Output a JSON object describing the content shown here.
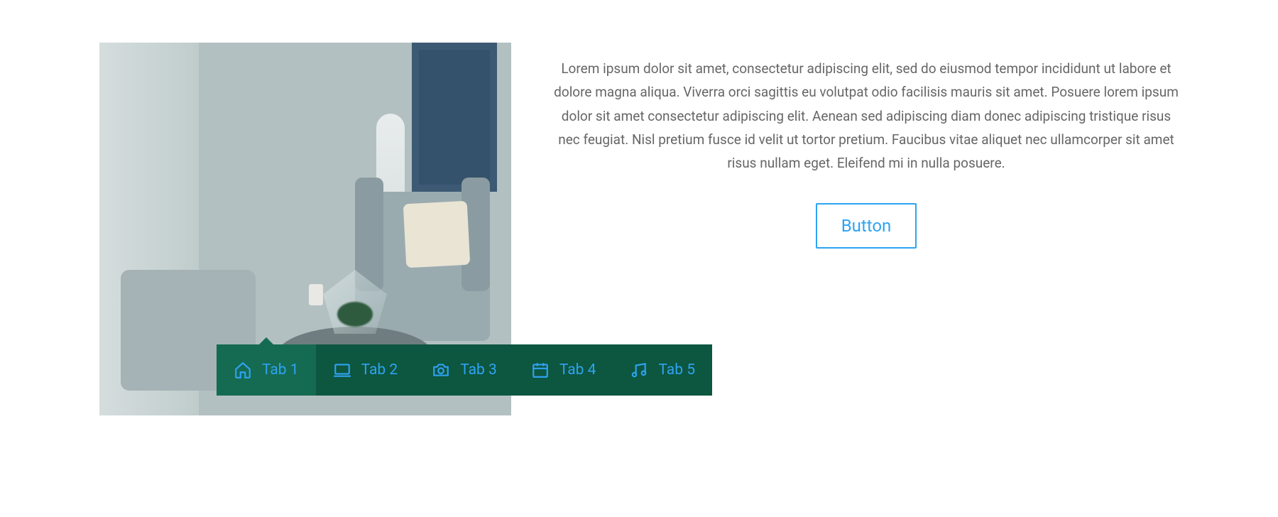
{
  "content": {
    "description": "Lorem ipsum dolor sit amet, consectetur adipiscing elit, sed do eiusmod tempor incididunt ut labore et dolore magna aliqua. Viverra orci sagittis eu volutpat odio facilisis mauris sit amet. Posuere lorem ipsum dolor sit amet consectetur adipiscing elit. Aenean sed adipiscing diam donec adipiscing tristique risus nec feugiat. Nisl pretium fusce id velit ut tortor pretium. Faucibus vitae aliquet nec ullamcorper sit amet risus nullam eget. Eleifend mi in nulla posuere.",
    "button_label": "Button"
  },
  "tabs": {
    "items": [
      {
        "label": "Tab 1",
        "icon": "home-icon",
        "active": true
      },
      {
        "label": "Tab 2",
        "icon": "laptop-icon",
        "active": false
      },
      {
        "label": "Tab 3",
        "icon": "camera-icon",
        "active": false
      },
      {
        "label": "Tab 4",
        "icon": "calendar-icon",
        "active": false
      },
      {
        "label": "Tab 5",
        "icon": "music-icon",
        "active": false
      }
    ]
  },
  "colors": {
    "accent": "#2ea3f2",
    "tabbar_bg": "#0d5640",
    "tabbar_active": "#156b52",
    "text_muted": "#666"
  }
}
